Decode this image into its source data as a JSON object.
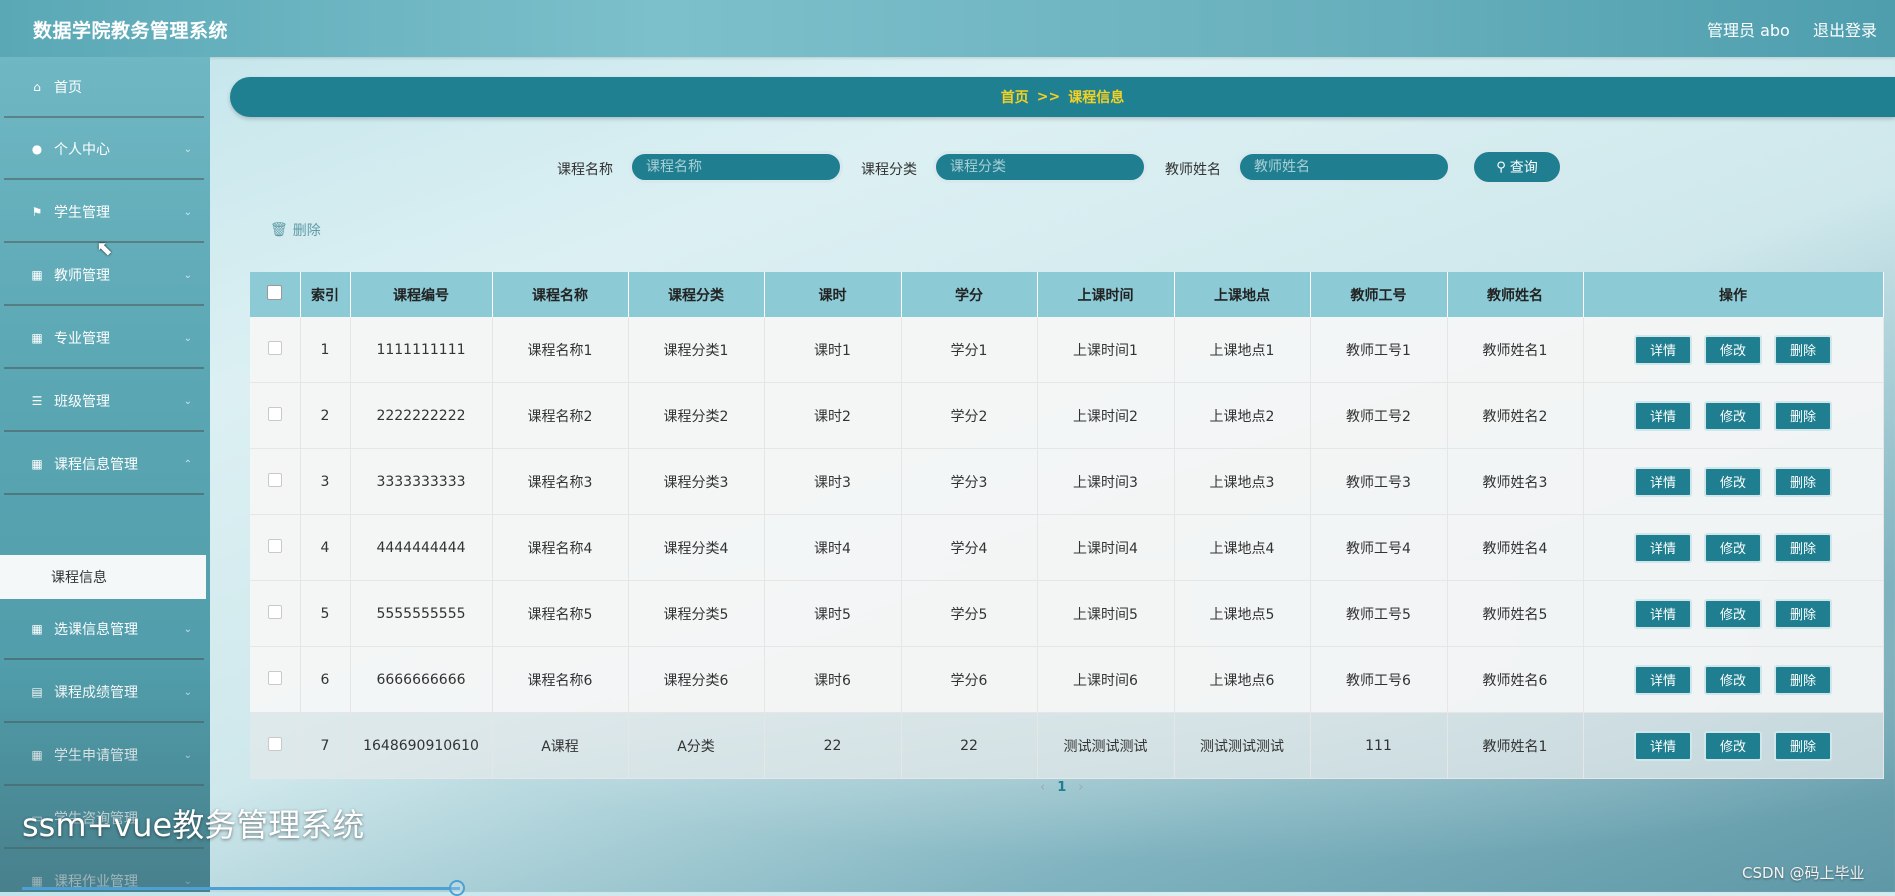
{
  "header": {
    "app_title": "数据学院教务管理系统",
    "user_info": "管理员 abo",
    "logout": "退出登录"
  },
  "sidebar": {
    "items": [
      {
        "label": "首页",
        "icon": "home-icon"
      },
      {
        "label": "个人中心",
        "icon": "user-icon"
      },
      {
        "label": "学生管理",
        "icon": "flag-icon"
      },
      {
        "label": "教师管理",
        "icon": "grid-icon"
      },
      {
        "label": "专业管理",
        "icon": "grid-icon"
      },
      {
        "label": "班级管理",
        "icon": "list-icon"
      },
      {
        "label": "课程信息管理",
        "icon": "grid-icon"
      },
      {
        "label": "选课信息管理",
        "icon": "grid-icon"
      },
      {
        "label": "课程成绩管理",
        "icon": "briefcase-icon"
      },
      {
        "label": "学生申请管理",
        "icon": "grid-icon"
      },
      {
        "label": "学生咨询管理",
        "icon": "chat-icon"
      },
      {
        "label": "课程作业管理",
        "icon": "grid-icon"
      }
    ],
    "submenu_active": "课程信息"
  },
  "breadcrumb": {
    "home": "首页",
    "separator": ">>",
    "current": "课程信息"
  },
  "search": {
    "course_name_label": "课程名称",
    "course_name_placeholder": "课程名称",
    "course_category_label": "课程分类",
    "course_category_placeholder": "课程分类",
    "teacher_name_label": "教师姓名",
    "teacher_name_placeholder": "教师姓名",
    "query_button": "查询"
  },
  "toolbar": {
    "delete_label": "删除"
  },
  "table": {
    "columns": [
      "索引",
      "课程编号",
      "课程名称",
      "课程分类",
      "课时",
      "学分",
      "上课时间",
      "上课地点",
      "教师工号",
      "教师姓名",
      "操作"
    ],
    "rows": [
      [
        "1",
        "1111111111",
        "课程名称1",
        "课程分类1",
        "课时1",
        "学分1",
        "上课时间1",
        "上课地点1",
        "教师工号1",
        "教师姓名1"
      ],
      [
        "2",
        "2222222222",
        "课程名称2",
        "课程分类2",
        "课时2",
        "学分2",
        "上课时间2",
        "上课地点2",
        "教师工号2",
        "教师姓名2"
      ],
      [
        "3",
        "3333333333",
        "课程名称3",
        "课程分类3",
        "课时3",
        "学分3",
        "上课时间3",
        "上课地点3",
        "教师工号3",
        "教师姓名3"
      ],
      [
        "4",
        "4444444444",
        "课程名称4",
        "课程分类4",
        "课时4",
        "学分4",
        "上课时间4",
        "上课地点4",
        "教师工号4",
        "教师姓名4"
      ],
      [
        "5",
        "5555555555",
        "课程名称5",
        "课程分类5",
        "课时5",
        "学分5",
        "上课时间5",
        "上课地点5",
        "教师工号5",
        "教师姓名5"
      ],
      [
        "6",
        "6666666666",
        "课程名称6",
        "课程分类6",
        "课时6",
        "学分6",
        "上课时间6",
        "上课地点6",
        "教师工号6",
        "教师姓名6"
      ],
      [
        "7",
        "1648690910610",
        "A课程",
        "A分类",
        "22",
        "22",
        "测试测试测试",
        "测试测试测试",
        "111",
        "教师姓名1"
      ]
    ],
    "actions": {
      "detail": "详情",
      "edit": "修改",
      "delete": "删除"
    }
  },
  "pagination": {
    "prev": "‹",
    "current_page": "1",
    "next": "›"
  },
  "overlay": {
    "caption": "ssm+vue教务管理系统",
    "watermark": "CSDN @码上毕业"
  },
  "colors": {
    "primary": "#1f7f90",
    "breadcrumb_text": "#f2d024",
    "table_header": "#8ccad5"
  }
}
